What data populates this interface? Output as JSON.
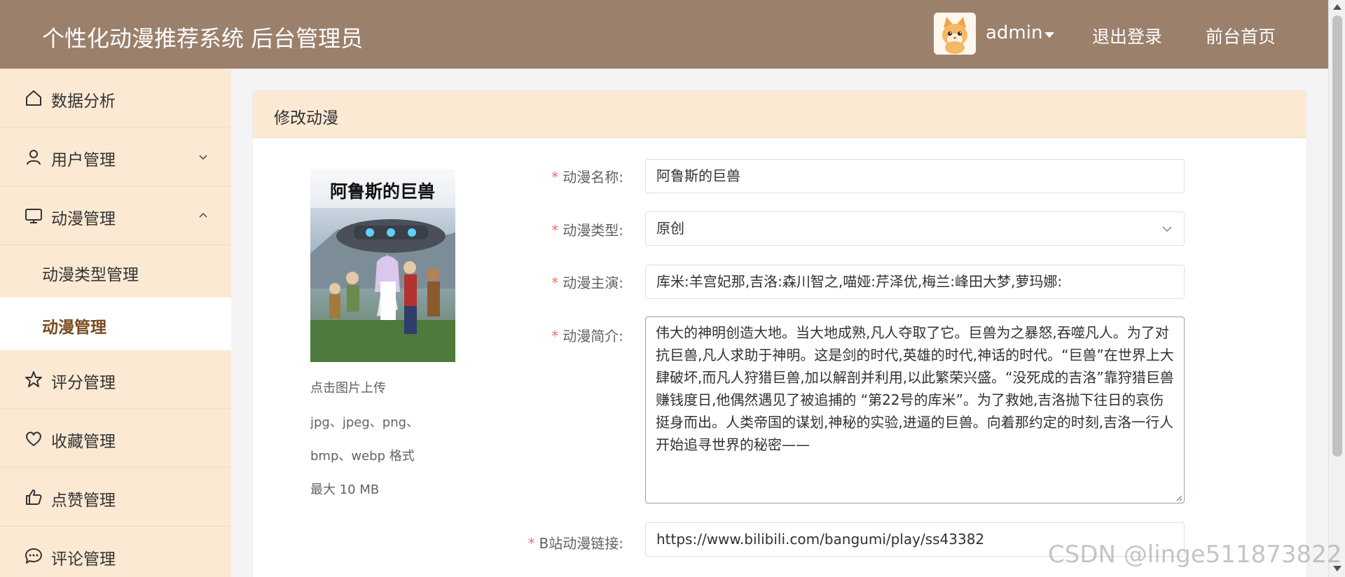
{
  "header": {
    "title": "个性化动漫推荐系统 后台管理员",
    "user": "admin",
    "logout": "退出登录",
    "home": "前台首页"
  },
  "sidebar": {
    "items": [
      {
        "label": "数据分析",
        "icon": "home-icon"
      },
      {
        "label": "用户管理",
        "icon": "user-icon",
        "expanded": false
      },
      {
        "label": "动漫管理",
        "icon": "monitor-icon",
        "expanded": true
      },
      {
        "label": "动漫类型管理",
        "sub": true
      },
      {
        "label": "动漫管理",
        "sub": true,
        "active": true
      },
      {
        "label": "评分管理",
        "icon": "star-icon"
      },
      {
        "label": "收藏管理",
        "icon": "heart-icon"
      },
      {
        "label": "点赞管理",
        "icon": "thumbs-up-icon"
      },
      {
        "label": "评论管理",
        "icon": "comment-icon"
      }
    ]
  },
  "card": {
    "title": "修改动漫"
  },
  "poster": {
    "caption": "阿鲁斯的巨兽"
  },
  "upload": {
    "hint": "点击图片上传",
    "formats1": "jpg、jpeg、png、",
    "formats2": "bmp、webp 格式",
    "size": "最大 10 MB"
  },
  "form": {
    "name_label": "动漫名称:",
    "name_value": "阿鲁斯的巨兽",
    "type_label": "动漫类型:",
    "type_value": "原创",
    "cast_label": "动漫主演:",
    "cast_value": "库米:羊宫妃那,吉洛:森川智之,喵娅:芹泽优,梅兰:峰田大梦,萝玛娜:",
    "intro_label": "动漫简介:",
    "intro_value": "伟大的神明创造大地。当大地成熟,凡人夺取了它。巨兽为之暴怒,吞噬凡人。为了对抗巨兽,凡人求助于神明。这是剑的时代,英雄的时代,神话的时代。“巨兽”在世界上大肆破坏,而凡人狩猎巨兽,加以解剖并利用,以此繁荣兴盛。“没死成的吉洛”靠狩猎巨兽赚钱度日,他偶然遇见了被追捕的 “第22号的库米”。为了救她,吉洛抛下往日的哀伤挺身而出。人类帝国的谋划,神秘的实验,进逼的巨兽。向着那约定的时刻,吉洛一行人开始追寻世界的秘密——",
    "link_label": "B站动漫链接:",
    "link_value": "https://www.bilibili.com/bangumi/play/ss43382"
  },
  "watermark": "CSDN @linge511873822",
  "colors": {
    "header": "#9b806c",
    "sidebar": "#fbe9d3",
    "required": "#f56c6c"
  }
}
